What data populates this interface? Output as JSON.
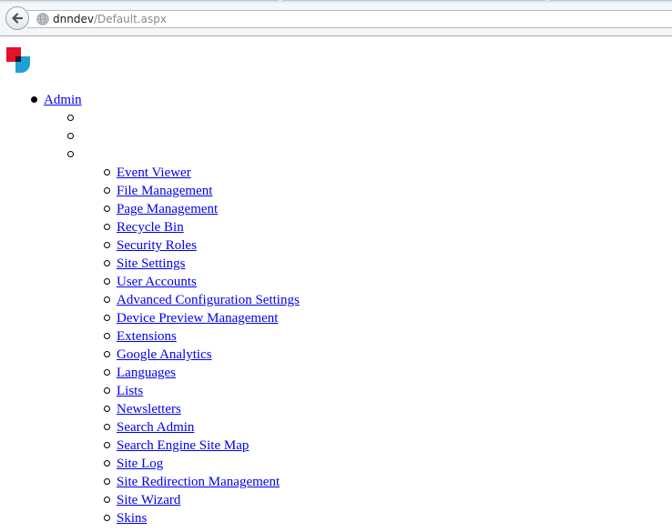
{
  "browser": {
    "url_host": "dnndev",
    "url_path": "/Default.aspx"
  },
  "menu": {
    "top_label": "Admin",
    "empty_items": 3,
    "items": [
      "Event Viewer",
      "File Management",
      "Page Management",
      "Recycle Bin",
      "Security Roles",
      "Site Settings",
      "User Accounts",
      "Advanced Configuration Settings",
      "Device Preview Management",
      "Extensions",
      "Google Analytics",
      "Languages",
      "Lists",
      "Newsletters",
      "Search Admin",
      "Search Engine Site Map",
      "Site Log",
      "Site Redirection Management",
      "Site Wizard",
      "Skins"
    ]
  },
  "colors": {
    "link": "#0000ee",
    "logo_red": "#e5102a",
    "logo_blue": "#1e9fd8",
    "logo_dark": "#1b1b2a"
  },
  "icons": {
    "back": "back-arrow-icon",
    "site": "globe-icon",
    "logo": "dnn-logo-icon"
  }
}
